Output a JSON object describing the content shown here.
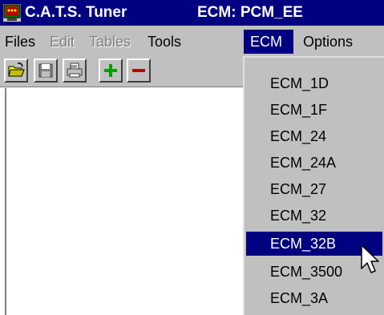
{
  "titlebar": {
    "app_title": "C.A.T.S. Tuner",
    "doc_title": "ECM: PCM_EE"
  },
  "menubar": {
    "items": [
      {
        "label": "Files",
        "state": "normal"
      },
      {
        "label": "Edit",
        "state": "disabled"
      },
      {
        "label": "Tables",
        "state": "disabled"
      },
      {
        "label": "Tools",
        "state": "normal"
      },
      {
        "label": "ECM",
        "state": "active"
      },
      {
        "label": "Options",
        "state": "normal"
      }
    ]
  },
  "toolbar": {
    "buttons": [
      "open-folder-icon",
      "save-disk-icon",
      "print-icon",
      "plus-icon",
      "minus-icon"
    ]
  },
  "dropdown": {
    "items": [
      {
        "label": "ECM_1D"
      },
      {
        "label": "ECM_1F"
      },
      {
        "label": "ECM_24"
      },
      {
        "label": "ECM_24A"
      },
      {
        "label": "ECM_27"
      },
      {
        "label": "ECM_32"
      },
      {
        "label": "ECM_32B",
        "selected": true
      },
      {
        "label": "ECM_3500"
      },
      {
        "label": "ECM_3A"
      }
    ]
  },
  "colors": {
    "titlebar_bg": "#000080",
    "chrome": "#c0c0c0",
    "highlight": "#000080",
    "plus_green": "#00a000",
    "minus_red": "#c00000"
  }
}
